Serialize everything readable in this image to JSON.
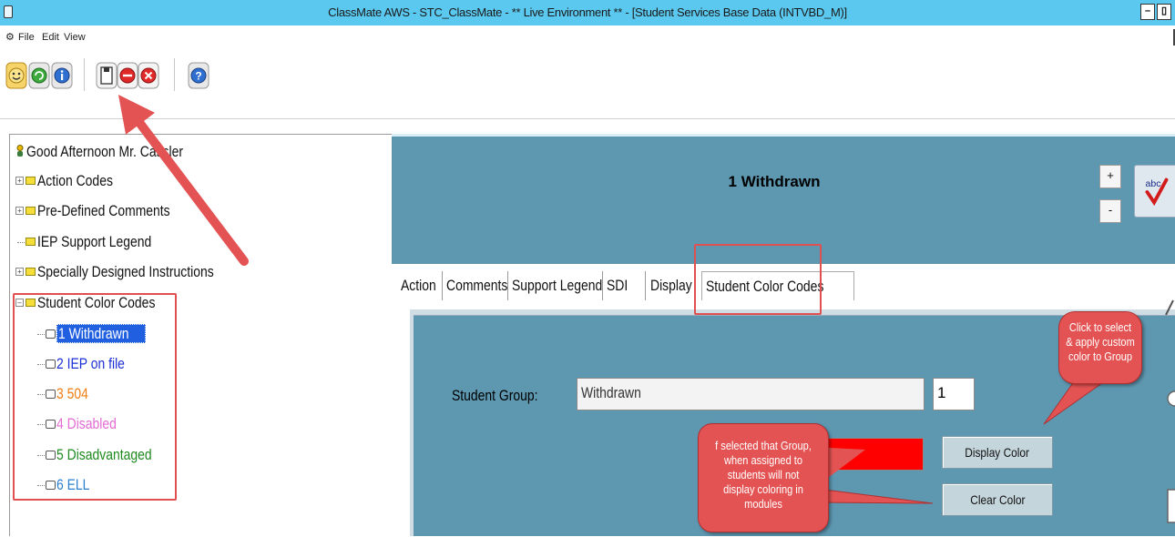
{
  "window": {
    "title": "ClassMate AWS - STC_ClassMate - ** Live Environment ** - [Student Services Base Data  (INTVBD_M)]",
    "minimize_label": "–",
    "restore_label": "▯"
  },
  "menu": {
    "items": [
      {
        "label": "File"
      },
      {
        "label": "Edit"
      },
      {
        "label": "View"
      }
    ]
  },
  "toolbar": {
    "icons": [
      "smiley-icon",
      "refresh-icon",
      "info-icon",
      "save-icon",
      "delete-icon",
      "close-icon",
      "help-icon"
    ]
  },
  "tree": {
    "greeting": "Good Afternoon Mr. Cassler",
    "nodes": [
      {
        "label": "Action Codes",
        "expandable": true
      },
      {
        "label": "Pre-Defined Comments",
        "expandable": true
      },
      {
        "label": "IEP Support Legend",
        "expandable": false
      },
      {
        "label": "Specially Designed Instructions",
        "expandable": true
      },
      {
        "label": "Student Color Codes",
        "expandable": true
      }
    ],
    "color_codes": [
      {
        "label": "1 Withdrawn",
        "color": "#ffffff",
        "selected": true
      },
      {
        "label": "2 IEP on file",
        "color": "#1c2fd6"
      },
      {
        "label": "3 504",
        "color": "#f07c12"
      },
      {
        "label": "4 Disabled",
        "color": "#e36bd3"
      },
      {
        "label": "5 Disadvantaged",
        "color": "#1f8a1f"
      },
      {
        "label": "6 ELL",
        "color": "#2a7fcf"
      }
    ]
  },
  "header": {
    "title": "1 Withdrawn",
    "plus_label": "+",
    "minus_label": "-"
  },
  "tabs": [
    {
      "label": "Action"
    },
    {
      "label": "Comments"
    },
    {
      "label": "Support Legend"
    },
    {
      "label": "SDI"
    },
    {
      "label": "Display"
    },
    {
      "label": "Student Color Codes",
      "active": true
    }
  ],
  "form": {
    "group_label": "Student Group:",
    "group_value": "Withdrawn",
    "order_value": "1",
    "selected_color": "#ff0000",
    "display_color_label": "Display Color",
    "clear_color_label": "Clear Color"
  },
  "annotations": {
    "callout_select": "Click to select & apply custom color to Group",
    "callout_clear": "f selected that Group, when assigned to students will not display coloring in modules"
  },
  "colors": {
    "title_bar": "#5bc8ef",
    "panel": "#5d97b0",
    "annotation_red": "#e45353",
    "selected_bg": "#1f5fe0"
  }
}
